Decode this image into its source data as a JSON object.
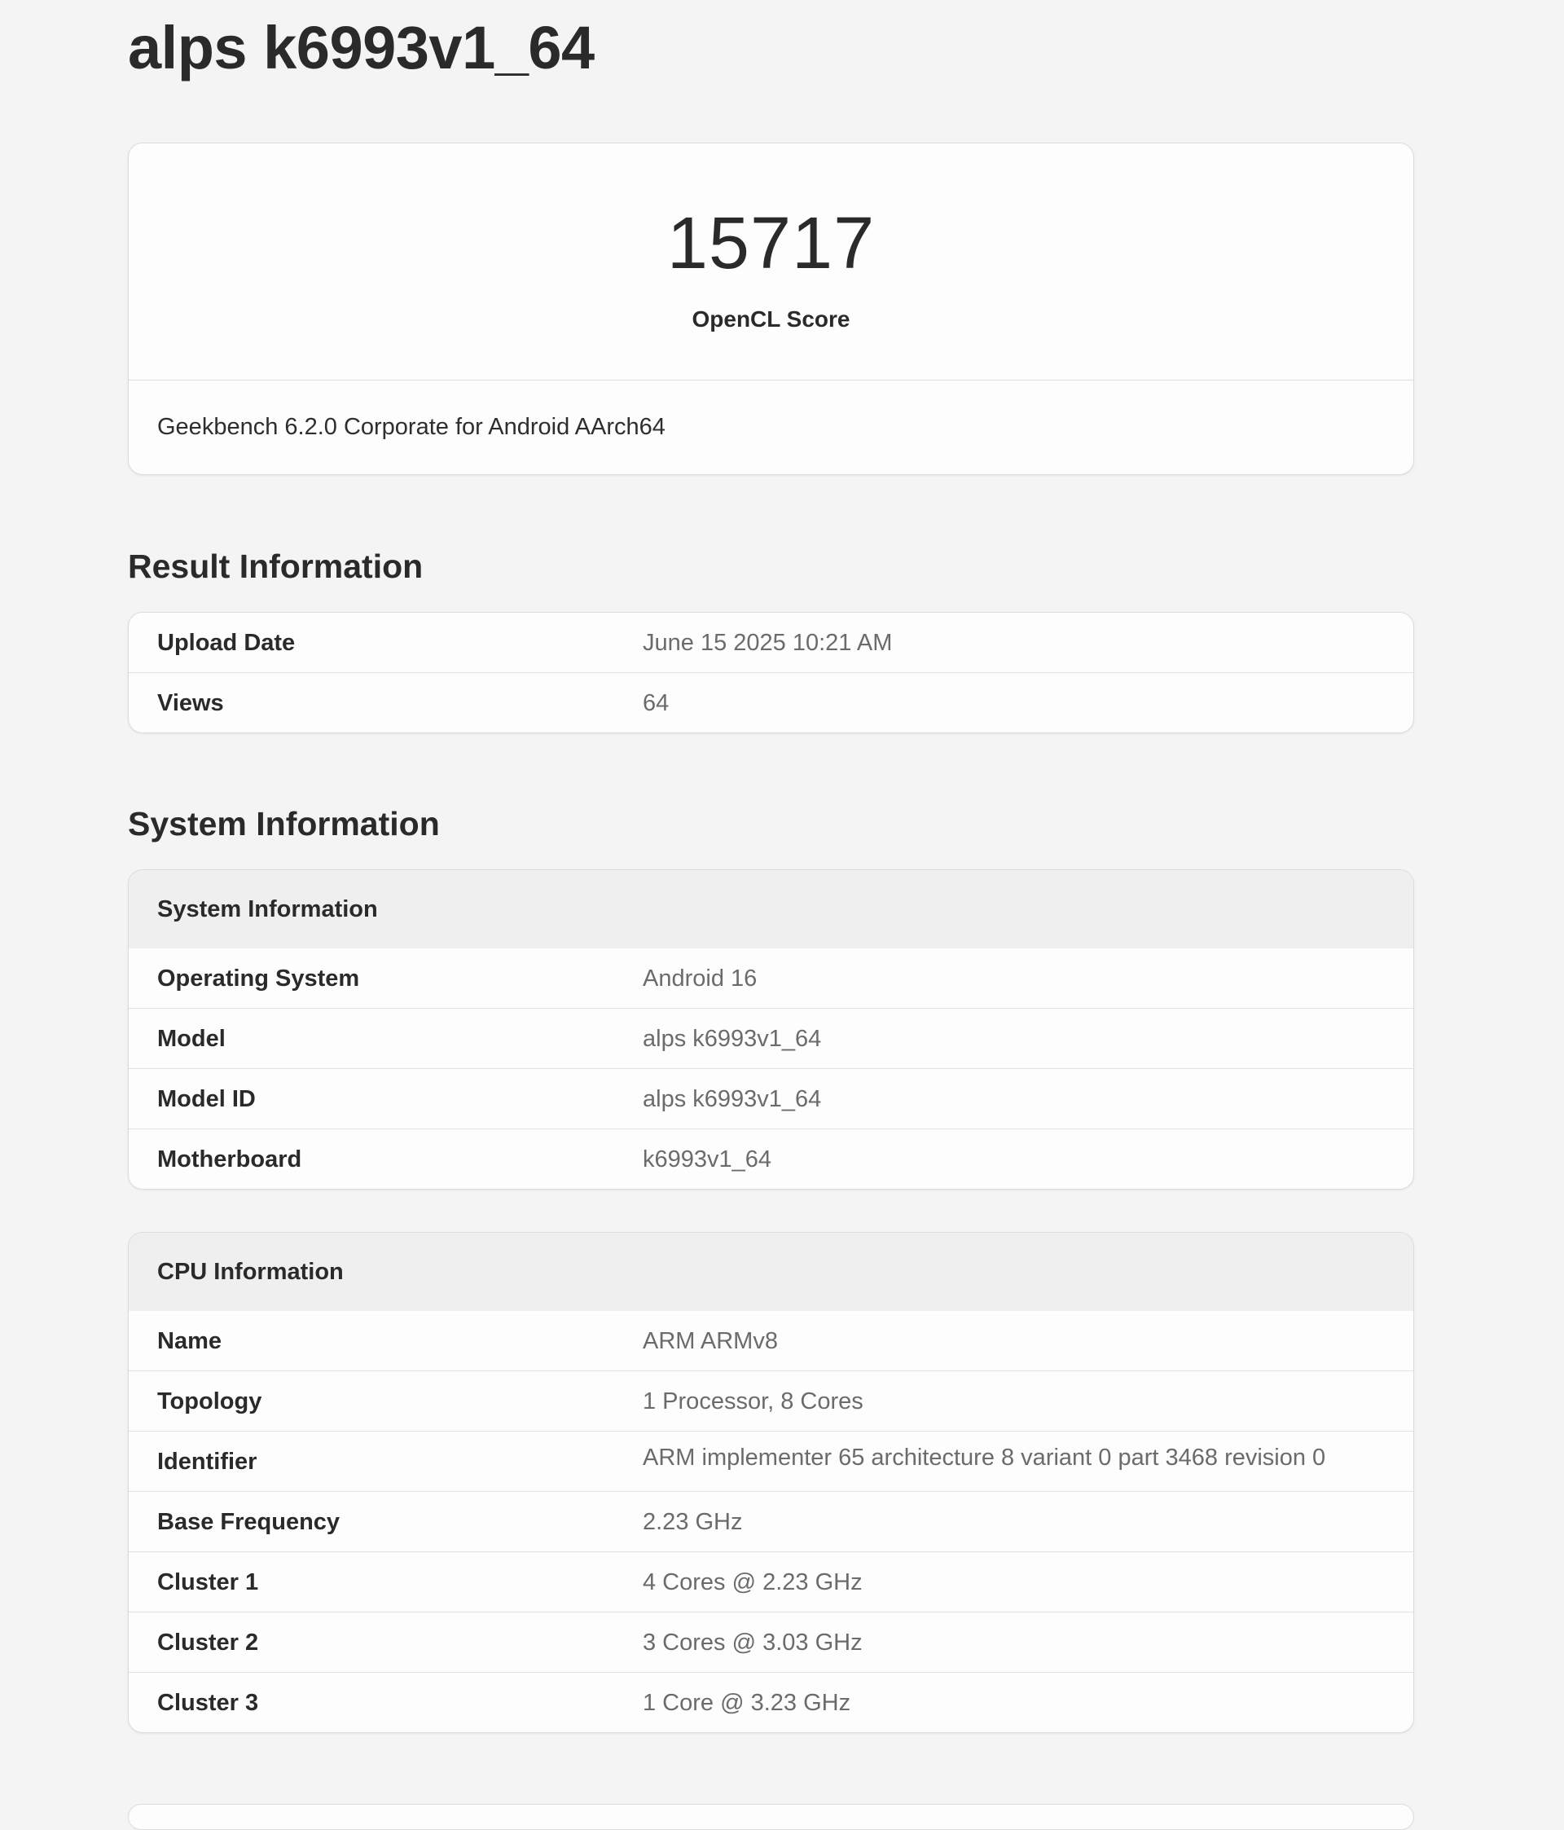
{
  "page": {
    "title": "alps k6993v1_64"
  },
  "score": {
    "value": "15717",
    "label": "OpenCL Score",
    "version": "Geekbench 6.2.0 Corporate for Android AArch64"
  },
  "result_information": {
    "heading": "Result Information",
    "rows": [
      {
        "label": "Upload Date",
        "value": "June 15 2025 10:21 AM"
      },
      {
        "label": "Views",
        "value": "64"
      }
    ]
  },
  "system_information": {
    "heading": "System Information",
    "system_table": {
      "header": "System Information",
      "rows": [
        {
          "label": "Operating System",
          "value": "Android 16"
        },
        {
          "label": "Model",
          "value": "alps k6993v1_64"
        },
        {
          "label": "Model ID",
          "value": "alps k6993v1_64"
        },
        {
          "label": "Motherboard",
          "value": "k6993v1_64"
        }
      ]
    },
    "cpu_table": {
      "header": "CPU Information",
      "rows": [
        {
          "label": "Name",
          "value": "ARM ARMv8"
        },
        {
          "label": "Topology",
          "value": "1 Processor, 8 Cores"
        },
        {
          "label": "Identifier",
          "value": "ARM implementer 65 architecture 8 variant 0 part 3468 revision 0"
        },
        {
          "label": "Base Frequency",
          "value": "2.23 GHz"
        },
        {
          "label": "Cluster 1",
          "value": "4 Cores @ 2.23 GHz"
        },
        {
          "label": "Cluster 2",
          "value": "3 Cores @ 3.03 GHz"
        },
        {
          "label": "Cluster 3",
          "value": "1 Core @ 3.23 GHz"
        }
      ]
    }
  },
  "colors": {
    "background": "#f4f4f5",
    "card": "#fdfdfd",
    "table_header": "#efeff0",
    "label_text": "#2a2a2a",
    "value_text": "#6b6b6e"
  }
}
